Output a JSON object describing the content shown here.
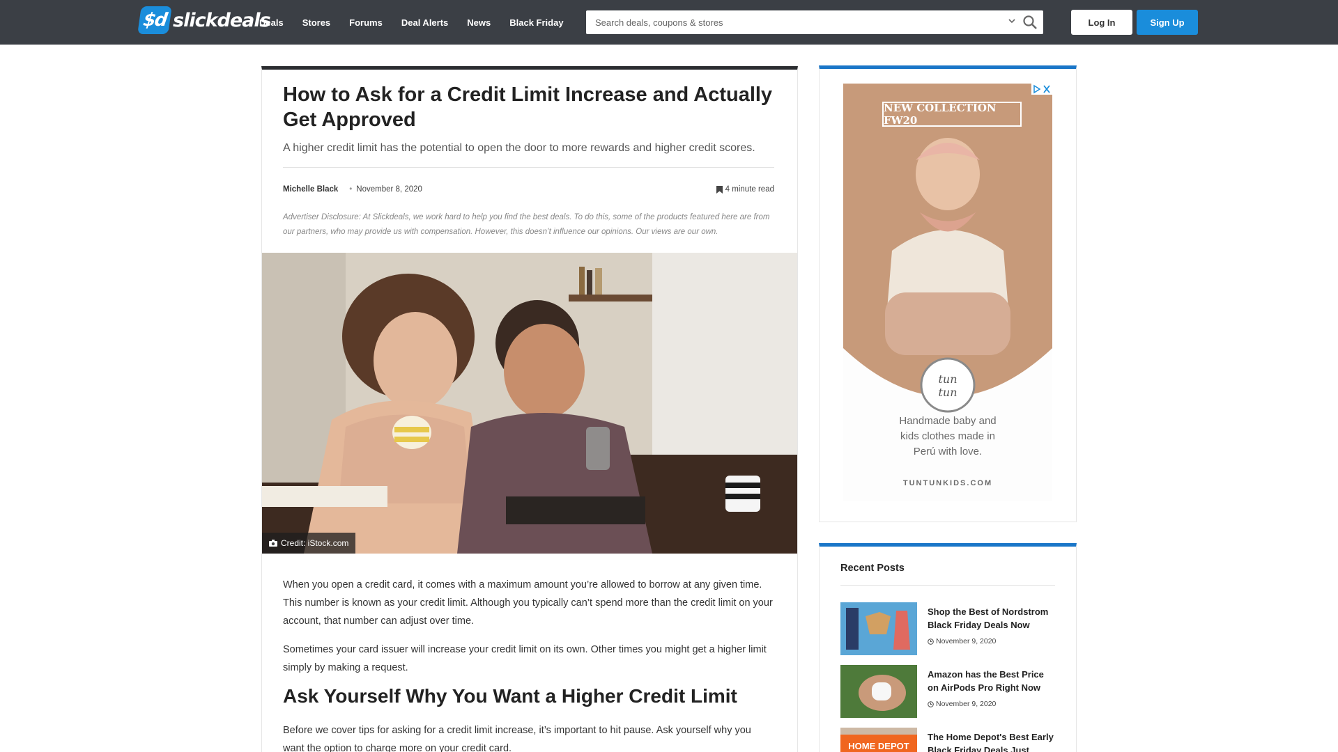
{
  "header": {
    "logo_mark": "$d",
    "logo_text": "slickdeals",
    "nav": [
      "Deals",
      "Stores",
      "Forums",
      "Deal Alerts",
      "News",
      "Black Friday"
    ],
    "search_placeholder": "Search deals, coupons & stores",
    "login_label": "Log In",
    "signup_label": "Sign Up"
  },
  "article": {
    "title": "How to Ask for a Credit Limit Increase and Actually Get Approved",
    "subtitle": "A higher credit limit has the potential to open the door to more rewards and higher credit scores.",
    "author": "Michelle Black",
    "date": "November 8, 2020",
    "read_time": "4 minute read",
    "disclosure": "Advertiser Disclosure: At Slickdeals, we work hard to help you find the best deals. To do this, some of the products featured here are from our partners, who may provide us with compensation. However, this doesn’t influence our opinions. Our views are our own.",
    "image_credit": "Credit: iStock.com",
    "paragraph1": "When you open a credit card, it comes with a maximum amount you’re allowed to borrow at any given time. This number is known as your credit limit. Although you typically can’t spend more than the credit limit on your account, that number can adjust over time.",
    "paragraph2": "Sometimes your card issuer will increase your credit limit on its own. Other times you might get a higher limit simply by making a request.",
    "heading2": "Ask Yourself Why You Want a Higher Credit Limit",
    "paragraph3": "Before we cover tips for asking for a credit limit increase, it’s important to hit pause. Ask yourself why you want the option to charge more on your credit card."
  },
  "ad": {
    "label": "NEW COLLECTION FW20",
    "brand_line1": "tun",
    "brand_line2": "tun",
    "body_line1": "Handmade baby and",
    "body_line2": "kids clothes made in",
    "body_line3": "Perú with love.",
    "url": "TUNTUNKIDS.COM"
  },
  "recent_posts": {
    "title": "Recent Posts",
    "items": [
      {
        "title": "Shop the Best of Nordstrom Black Friday Deals Now",
        "date": "November 9, 2020"
      },
      {
        "title": "Amazon has the Best Price on AirPods Pro Right Now",
        "date": "November 9, 2020"
      },
      {
        "title": "The Home Depot's Best Early Black Friday Deals Just",
        "date": "",
        "thumb_text": "HOME DEPOT"
      }
    ]
  },
  "colors": {
    "topbar": "#3b3f45",
    "accent_blue": "#1a8ddb",
    "sidebar_border": "#1a76c8"
  }
}
